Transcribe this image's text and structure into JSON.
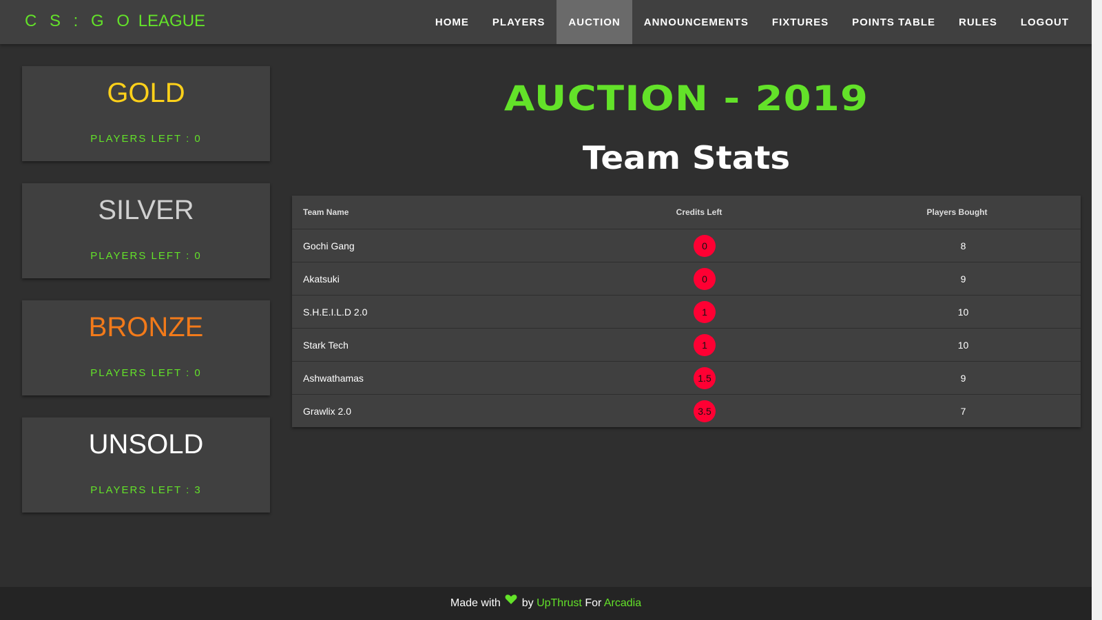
{
  "brand": {
    "prefix": "C S : G O",
    "suffix": "LEAGUE"
  },
  "nav": {
    "items": [
      {
        "label": "HOME",
        "name": "nav-home"
      },
      {
        "label": "PLAYERS",
        "name": "nav-players"
      },
      {
        "label": "AUCTION",
        "name": "nav-auction",
        "active": true
      },
      {
        "label": "ANNOUNCEMENTS",
        "name": "nav-announcements"
      },
      {
        "label": "FIXTURES",
        "name": "nav-fixtures"
      },
      {
        "label": "POINTS TABLE",
        "name": "nav-points-table"
      },
      {
        "label": "RULES",
        "name": "nav-rules"
      },
      {
        "label": "LOGOUT",
        "name": "nav-logout"
      }
    ]
  },
  "sidebar": {
    "cards": [
      {
        "title": "GOLD",
        "count_text": "PLAYERS LEFT : 0",
        "color": "#ffd11a"
      },
      {
        "title": "SILVER",
        "count_text": "PLAYERS LEFT : 0",
        "color": "#d0d0d0"
      },
      {
        "title": "BRONZE",
        "count_text": "PLAYERS LEFT : 0",
        "color": "#f27a1a"
      },
      {
        "title": "UNSOLD",
        "count_text": "PLAYERS LEFT : 3",
        "color": "#ffffff"
      }
    ]
  },
  "main": {
    "title": "AUCTION - 2019",
    "section_title": "Team Stats",
    "table": {
      "headers": {
        "team": "Team Name",
        "credits": "Credits Left",
        "players": "Players Bought"
      },
      "rows": [
        {
          "team": "Gochi Gang",
          "credits": "0",
          "players": "8"
        },
        {
          "team": "Akatsuki",
          "credits": "0",
          "players": "9"
        },
        {
          "team": "S.H.E.I.L.D 2.0",
          "credits": "1",
          "players": "10"
        },
        {
          "team": "Stark Tech",
          "credits": "1",
          "players": "10"
        },
        {
          "team": "Ashwathamas",
          "credits": "1.5",
          "players": "9"
        },
        {
          "team": "Grawlix 2.0",
          "credits": "3.5",
          "players": "7"
        }
      ]
    }
  },
  "footer": {
    "made_with": "Made with",
    "heart_icon": "green-heart-icon",
    "by": "by",
    "author": "UpThrust",
    "for": "For",
    "event": "Arcadia"
  },
  "colors": {
    "accent": "#63e229",
    "credit_pill": "#ff0033",
    "navbar": "#404040",
    "background": "#2f2f2f"
  }
}
